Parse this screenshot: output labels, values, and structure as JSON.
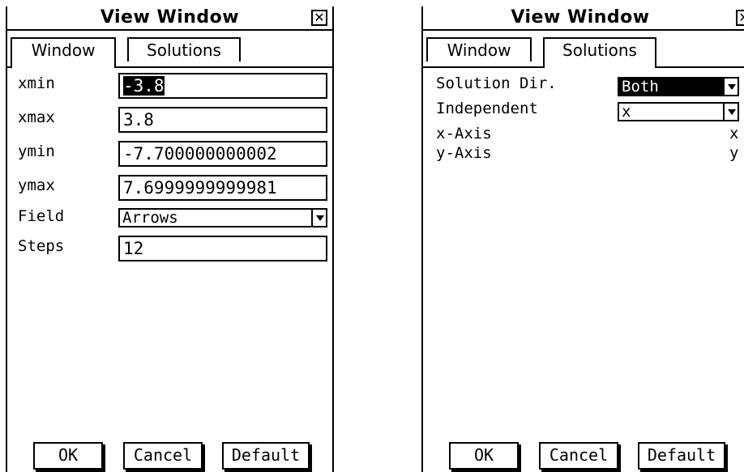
{
  "left": {
    "title": "View Window",
    "close_glyph": "✕",
    "tabs": [
      {
        "label": "Window"
      },
      {
        "label": "Solutions"
      }
    ],
    "active_tab": "Window",
    "fields": {
      "xmin": {
        "label": "xmin",
        "value": "-3.8"
      },
      "xmax": {
        "label": "xmax",
        "value": "3.8"
      },
      "ymin": {
        "label": "ymin",
        "value": "-7.700000000002"
      },
      "ymax": {
        "label": "ymax",
        "value": "7.6999999999981"
      },
      "field": {
        "label": "Field",
        "value": "Arrows"
      },
      "steps": {
        "label": "Steps",
        "value": "12"
      }
    },
    "buttons": {
      "ok": "OK",
      "cancel": "Cancel",
      "default": "Default"
    }
  },
  "right": {
    "title": "View Window",
    "close_glyph": "✕",
    "tabs": [
      {
        "label": "Window"
      },
      {
        "label": "Solutions"
      }
    ],
    "active_tab": "Solutions",
    "solution_dir": {
      "label": "Solution Dir.",
      "value": "Both"
    },
    "independent": {
      "label": "Independent",
      "value": "x"
    },
    "x_axis": {
      "label": "x-Axis",
      "value": "x"
    },
    "y_axis": {
      "label": "y-Axis",
      "value": "y"
    },
    "buttons": {
      "ok": "OK",
      "cancel": "Cancel",
      "default": "Default"
    }
  }
}
